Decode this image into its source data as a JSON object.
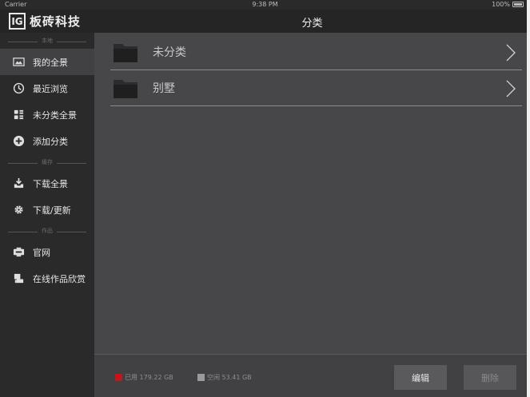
{
  "status_bar": {
    "carrier": "Carrier",
    "time": "9:38 PM",
    "battery": "100%"
  },
  "header": {
    "brand_mark": "IG",
    "brand_name": "板砖科技",
    "title": "分类"
  },
  "sidebar": {
    "sections": [
      {
        "heading": "本地",
        "items": [
          {
            "label": "我的全景",
            "icon": "image-icon",
            "active": true
          },
          {
            "label": "最近浏览",
            "icon": "clock-icon",
            "active": false
          },
          {
            "label": "未分类全景",
            "icon": "grid-icon",
            "active": false
          },
          {
            "label": "添加分类",
            "icon": "plus-circle-icon",
            "active": false
          }
        ]
      },
      {
        "heading": "缓存",
        "items": [
          {
            "label": "下载全景",
            "icon": "download-tray-icon",
            "active": false
          },
          {
            "label": "下载/更新",
            "icon": "gear-icon",
            "active": false
          }
        ]
      },
      {
        "heading": "作品",
        "items": [
          {
            "label": "官网",
            "icon": "web-icon",
            "active": false
          },
          {
            "label": "在线作品欣赏",
            "icon": "gallery-icon",
            "active": false
          }
        ]
      }
    ]
  },
  "main": {
    "folders": [
      {
        "label": "未分类",
        "icon": "folder-icon"
      },
      {
        "label": "别墅",
        "icon": "folder-icon"
      }
    ]
  },
  "footer": {
    "storage": {
      "used": {
        "label": "已用 179.22 GB",
        "color": "#c0161c"
      },
      "free": {
        "label": "空闲 53.41 GB",
        "color": "#9a9a9a"
      }
    },
    "edit_label": "编辑",
    "delete_label": "删除"
  }
}
